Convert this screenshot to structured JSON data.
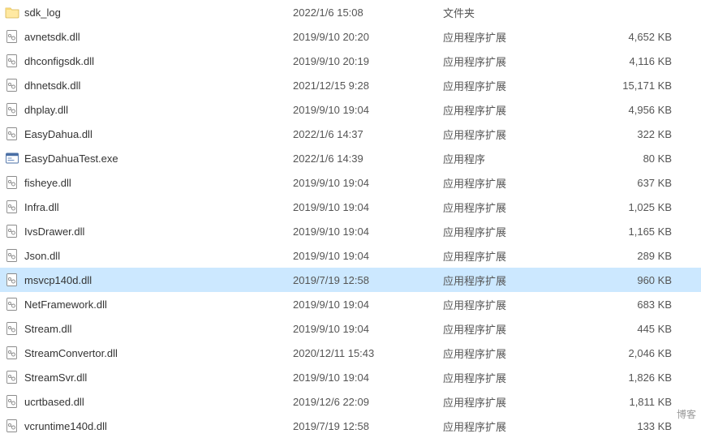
{
  "watermark": "博客",
  "icons": {
    "folder": "folder-icon",
    "dll": "dll-icon",
    "exe": "exe-icon"
  },
  "files": [
    {
      "icon": "folder",
      "name": "sdk_log",
      "date": "2022/1/6 15:08",
      "type": "文件夹",
      "size": "",
      "selected": false
    },
    {
      "icon": "dll",
      "name": "avnetsdk.dll",
      "date": "2019/9/10 20:20",
      "type": "应用程序扩展",
      "size": "4,652 KB",
      "selected": false
    },
    {
      "icon": "dll",
      "name": "dhconfigsdk.dll",
      "date": "2019/9/10 20:19",
      "type": "应用程序扩展",
      "size": "4,116 KB",
      "selected": false
    },
    {
      "icon": "dll",
      "name": "dhnetsdk.dll",
      "date": "2021/12/15 9:28",
      "type": "应用程序扩展",
      "size": "15,171 KB",
      "selected": false
    },
    {
      "icon": "dll",
      "name": "dhplay.dll",
      "date": "2019/9/10 19:04",
      "type": "应用程序扩展",
      "size": "4,956 KB",
      "selected": false
    },
    {
      "icon": "dll",
      "name": "EasyDahua.dll",
      "date": "2022/1/6 14:37",
      "type": "应用程序扩展",
      "size": "322 KB",
      "selected": false
    },
    {
      "icon": "exe",
      "name": "EasyDahuaTest.exe",
      "date": "2022/1/6 14:39",
      "type": "应用程序",
      "size": "80 KB",
      "selected": false
    },
    {
      "icon": "dll",
      "name": "fisheye.dll",
      "date": "2019/9/10 19:04",
      "type": "应用程序扩展",
      "size": "637 KB",
      "selected": false
    },
    {
      "icon": "dll",
      "name": "Infra.dll",
      "date": "2019/9/10 19:04",
      "type": "应用程序扩展",
      "size": "1,025 KB",
      "selected": false
    },
    {
      "icon": "dll",
      "name": "IvsDrawer.dll",
      "date": "2019/9/10 19:04",
      "type": "应用程序扩展",
      "size": "1,165 KB",
      "selected": false
    },
    {
      "icon": "dll",
      "name": "Json.dll",
      "date": "2019/9/10 19:04",
      "type": "应用程序扩展",
      "size": "289 KB",
      "selected": false
    },
    {
      "icon": "dll",
      "name": "msvcp140d.dll",
      "date": "2019/7/19 12:58",
      "type": "应用程序扩展",
      "size": "960 KB",
      "selected": true
    },
    {
      "icon": "dll",
      "name": "NetFramework.dll",
      "date": "2019/9/10 19:04",
      "type": "应用程序扩展",
      "size": "683 KB",
      "selected": false
    },
    {
      "icon": "dll",
      "name": "Stream.dll",
      "date": "2019/9/10 19:04",
      "type": "应用程序扩展",
      "size": "445 KB",
      "selected": false
    },
    {
      "icon": "dll",
      "name": "StreamConvertor.dll",
      "date": "2020/12/11 15:43",
      "type": "应用程序扩展",
      "size": "2,046 KB",
      "selected": false
    },
    {
      "icon": "dll",
      "name": "StreamSvr.dll",
      "date": "2019/9/10 19:04",
      "type": "应用程序扩展",
      "size": "1,826 KB",
      "selected": false
    },
    {
      "icon": "dll",
      "name": "ucrtbased.dll",
      "date": "2019/12/6 22:09",
      "type": "应用程序扩展",
      "size": "1,811 KB",
      "selected": false
    },
    {
      "icon": "dll",
      "name": "vcruntime140d.dll",
      "date": "2019/7/19 12:58",
      "type": "应用程序扩展",
      "size": "133 KB",
      "selected": false
    }
  ]
}
